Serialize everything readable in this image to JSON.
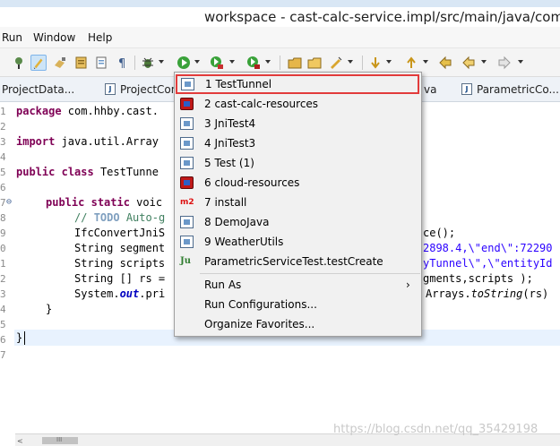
{
  "window": {
    "title": "workspace - cast-calc-service.impl/src/main/java/com/h"
  },
  "menubar": {
    "items": [
      "Run",
      "Window",
      "Help"
    ]
  },
  "tabs": [
    {
      "label": "ProjectData..."
    },
    {
      "label": "ProjectCon"
    },
    {
      "label": "va"
    },
    {
      "label": "ParametricCo..."
    }
  ],
  "editor": {
    "line_numbers": [
      "1",
      "2",
      "3",
      "4",
      "5",
      "6",
      "7",
      "8",
      "9",
      "0",
      "1",
      "2",
      "3",
      "4",
      "5",
      "6",
      "7"
    ],
    "fold_marker": "⊖",
    "lines": {
      "l1_kw": "package",
      "l1_rest": " com.hhby.cast.",
      "l3_kw": "import",
      "l3_rest": " java.util.Array",
      "l5_kw1": "public",
      "l5_kw2": "class",
      "l5_rest": " TestTunne",
      "l7_kw1": "public",
      "l7_kw2": "static",
      "l7_rest": " voic",
      "l8_cm1": "// ",
      "l8_todo": "TODO",
      "l8_cm2": " Auto-g",
      "l9_left": "IfcConvertJniS",
      "l9_right": "ce();",
      "l10_left": "String segment",
      "l10_right": "2898.4,\\\"end\\\":72290",
      "l11_left": "String scripts",
      "l11_right": "yTunnel\\\",\\\"entityId",
      "l12_left": "String [] rs =",
      "l12_right": "gments,scripts );",
      "l13_left": "System.",
      "l13_field": "out",
      "l13_mid": ".pri",
      "l13_r1": "Arrays.",
      "l13_r2": "toString",
      "l13_r3": "(rs)",
      "l14": "}",
      "l16": "}"
    }
  },
  "menu": {
    "items": [
      {
        "label": "1 TestTunnel",
        "icon": "java-app-icon",
        "highlighted": true
      },
      {
        "label": "2 cast-calc-resources",
        "icon": "external-tool-icon"
      },
      {
        "label": "3 JniTest4",
        "icon": "java-app-icon"
      },
      {
        "label": "4 JniTest3",
        "icon": "java-app-icon"
      },
      {
        "label": "5 Test (1)",
        "icon": "java-app-icon"
      },
      {
        "label": "6 cloud-resources",
        "icon": "external-tool-icon"
      },
      {
        "label": "7 install",
        "icon": "maven-icon",
        "icon_text": "m2"
      },
      {
        "label": "8 DemoJava",
        "icon": "java-app-icon"
      },
      {
        "label": "9 WeatherUtils",
        "icon": "java-app-icon"
      },
      {
        "label": "ParametricServiceTest.testCreate",
        "icon": "junit-icon",
        "icon_text": "Ju"
      },
      {
        "label": "Run As"
      },
      {
        "label": "Run Configurations..."
      },
      {
        "label": "Organize Favorites..."
      }
    ],
    "submenu_arrow": "›"
  },
  "scrollbar": {
    "left_arrow": "<",
    "grip": "III"
  },
  "watermark": "https://blog.csdn.net/qq_35429198",
  "colors": {
    "highlight_border": "#e23b3b",
    "keyword": "#7f0055",
    "string": "#2a00ff",
    "comment": "#3f7f5f"
  }
}
